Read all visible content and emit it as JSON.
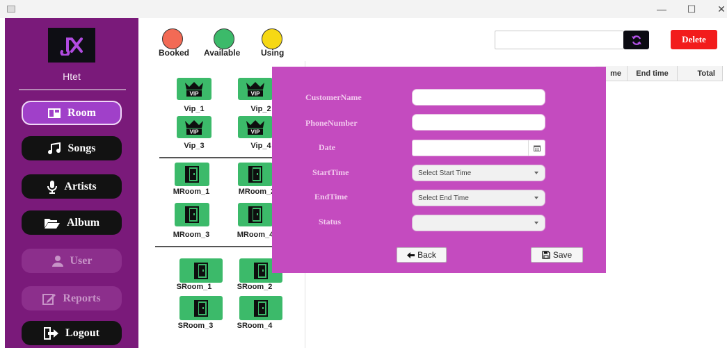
{
  "window": {
    "minimize": "—",
    "maximize": "☐",
    "close": "✕"
  },
  "sidebar": {
    "user_name": "Htet",
    "items": [
      {
        "label": "Room",
        "state": "active"
      },
      {
        "label": "Songs",
        "state": "normal"
      },
      {
        "label": "Artists",
        "state": "normal"
      },
      {
        "label": "Album",
        "state": "normal"
      },
      {
        "label": "User",
        "state": "disabled"
      },
      {
        "label": "Reports",
        "state": "disabled"
      },
      {
        "label": "Logout",
        "state": "normal"
      }
    ]
  },
  "legend": [
    {
      "label": "Booked",
      "color": "#f26a55"
    },
    {
      "label": "Available",
      "color": "#3cba6a"
    },
    {
      "label": "Using",
      "color": "#f6d814"
    }
  ],
  "rooms": {
    "vip": [
      "Vip_1",
      "Vip_2",
      "Vip_3",
      "Vip_4"
    ],
    "medium": [
      "MRoom_1",
      "MRoom_2",
      "MRoom_3",
      "MRoom_4"
    ],
    "small": [
      "SRoom_1",
      "SRoom_2",
      "SRoom_3",
      "SRoom_4"
    ]
  },
  "toolbar": {
    "search_value": "",
    "delete_label": "Delete"
  },
  "table": {
    "columns": [
      "me",
      "End time",
      "Total"
    ]
  },
  "dialog": {
    "fields": {
      "customer_name": {
        "label": "CustomerName",
        "value": ""
      },
      "phone_number": {
        "label": "PhoneNumber",
        "value": ""
      },
      "date": {
        "label": "Date",
        "value": ""
      },
      "start_time": {
        "label": "StartTime",
        "placeholder": "Select Start Time"
      },
      "end_time": {
        "label": "EndTime",
        "placeholder": "Select End Time"
      },
      "status": {
        "label": "Status",
        "value": ""
      }
    },
    "back_label": "Back",
    "save_label": "Save"
  },
  "colors": {
    "sidebar": "#7a1a7a",
    "accent": "#a040c9",
    "dialog": "#c44bbf",
    "room": "#3cba6a",
    "delete": "#f21c1c"
  }
}
